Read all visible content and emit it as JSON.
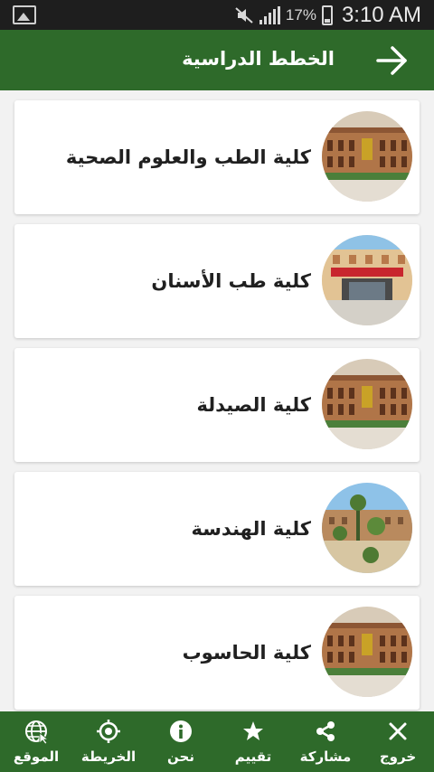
{
  "status_bar": {
    "battery": "17%",
    "time": "3:10 AM"
  },
  "app_bar": {
    "title": "الخطط الدراسية",
    "back_icon": "arrow-right-icon"
  },
  "colleges": [
    {
      "name": "كلية الطب والعلوم الصحية",
      "image": "college-building-photo"
    },
    {
      "name": "كلية طب الأسنان",
      "image": "dentistry-building-photo"
    },
    {
      "name": "كلية الصيدلة",
      "image": "college-building-photo"
    },
    {
      "name": "كلية الهندسة",
      "image": "engineering-campus-photo"
    },
    {
      "name": "كلية الحاسوب",
      "image": "college-building-photo"
    }
  ],
  "bottom_nav": [
    {
      "label": "خروج",
      "icon": "close-icon"
    },
    {
      "label": "مشاركة",
      "icon": "share-icon"
    },
    {
      "label": "تقييم",
      "icon": "star-icon"
    },
    {
      "label": "نحن",
      "icon": "info-icon"
    },
    {
      "label": "الخريطة",
      "icon": "location-target-icon"
    },
    {
      "label": "الموقع",
      "icon": "globe-icon"
    }
  ],
  "colors": {
    "primary": "#2e6a2a",
    "status_bar": "#1e1e1e",
    "card": "#ffffff",
    "background": "#f2f2f2"
  }
}
